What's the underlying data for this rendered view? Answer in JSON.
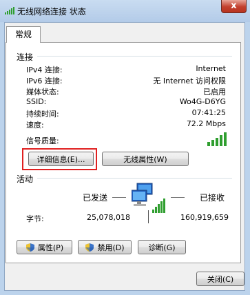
{
  "window": {
    "title": "无线网络连接 状态",
    "close_label": "x"
  },
  "tabs": [
    {
      "label": "常规"
    }
  ],
  "connection": {
    "header": "连接",
    "rows": [
      {
        "label": "IPv4 连接:",
        "value": "Internet"
      },
      {
        "label": "IPv6 连接:",
        "value": "无 Internet 访问权限"
      },
      {
        "label": "媒体状态:",
        "value": "已启用"
      },
      {
        "label": "SSID:",
        "value": "Wo4G-D6YG"
      },
      {
        "label": "持续时间:",
        "value": "07:41:25"
      },
      {
        "label": "速度:",
        "value": "72.2 Mbps"
      }
    ],
    "signal_label": "信号质量:",
    "signal_icon": "signal-bars-icon",
    "details_button": "详细信息(E)...",
    "wireless_props_button": "无线属性(W)"
  },
  "activity": {
    "header": "活动",
    "sent_label": "已发送",
    "received_label": "已接收",
    "bytes_label": "字节:",
    "sent_bytes": "25,078,018",
    "received_bytes": "160,919,659",
    "network_icon": "network-computers-icon"
  },
  "actions": {
    "properties_button": "属性(P)",
    "disable_button": "禁用(D)",
    "diagnose_button": "诊断(G)"
  },
  "footer": {
    "close_button": "关闭(C)"
  },
  "colors": {
    "signal_green": "#2f9e2f",
    "highlight_red": "#e02020"
  }
}
